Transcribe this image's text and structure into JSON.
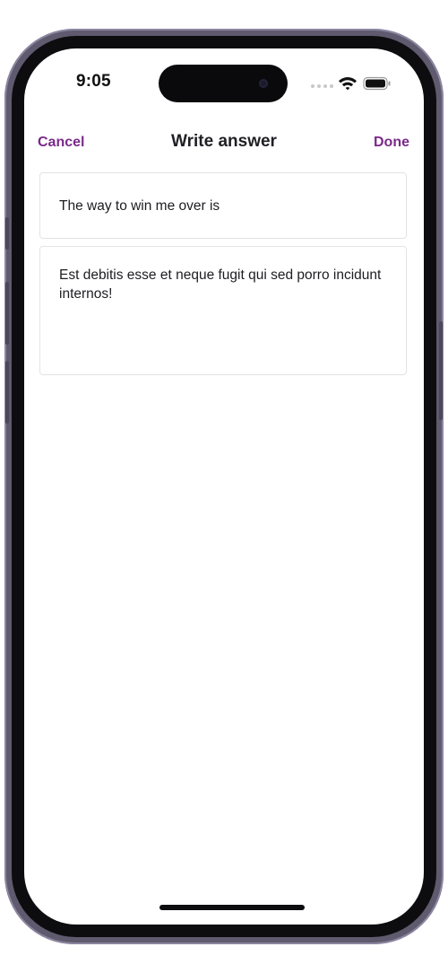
{
  "status_bar": {
    "time": "9:05",
    "wifi_icon": "wifi-icon",
    "battery_icon": "battery-icon"
  },
  "nav": {
    "cancel_label": "Cancel",
    "title": "Write answer",
    "done_label": "Done"
  },
  "form": {
    "prompt_text": "The way to win me over is",
    "answer_text": "Est debitis esse et neque fugit qui sed porro incidunt internos!"
  },
  "colors": {
    "accent": "#7a2a8a",
    "text": "#1d1d22",
    "field_border": "#e3e3e6"
  }
}
